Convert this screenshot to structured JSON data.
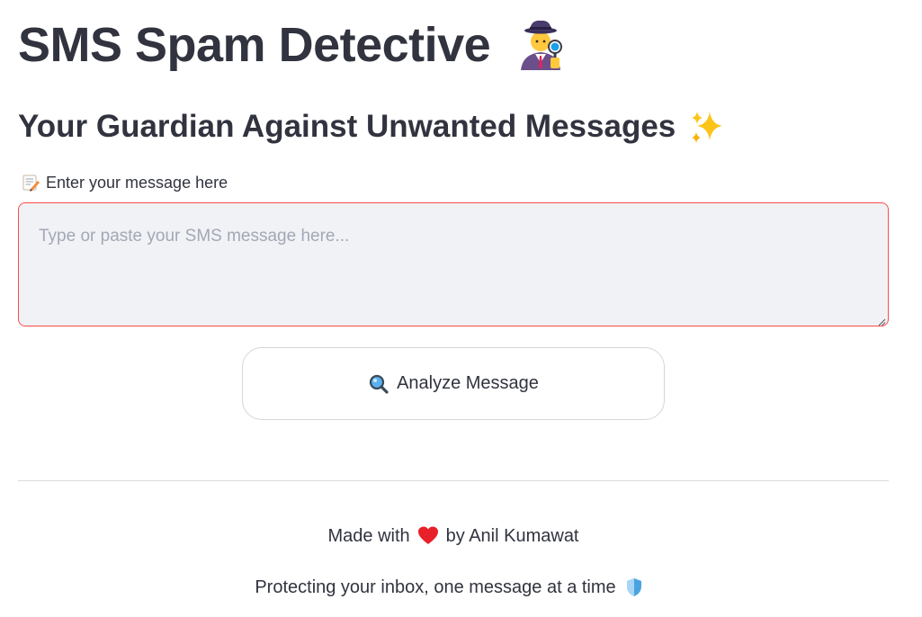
{
  "header": {
    "title": "SMS Spam Detective",
    "title_icon": "detective-icon",
    "subtitle": "Your Guardian Against Unwanted Messages",
    "subtitle_icon": "sparkles-icon"
  },
  "input": {
    "label": "Enter your message here",
    "label_icon": "memo-icon",
    "value": "",
    "placeholder": "Type or paste your SMS message here..."
  },
  "actions": {
    "analyze_label": "Analyze Message",
    "analyze_icon": "magnifier-icon"
  },
  "footer": {
    "made_with_prefix": "Made with",
    "made_with_icon": "heart-icon",
    "made_with_suffix": "by Anil Kumawat",
    "tagline": "Protecting your inbox, one message at a time",
    "tagline_icon": "shield-icon"
  },
  "colors": {
    "text": "#31333f",
    "input_bg": "#f0f2f6",
    "input_border_focus": "#ff4b4b",
    "placeholder": "#a3a8b4"
  }
}
